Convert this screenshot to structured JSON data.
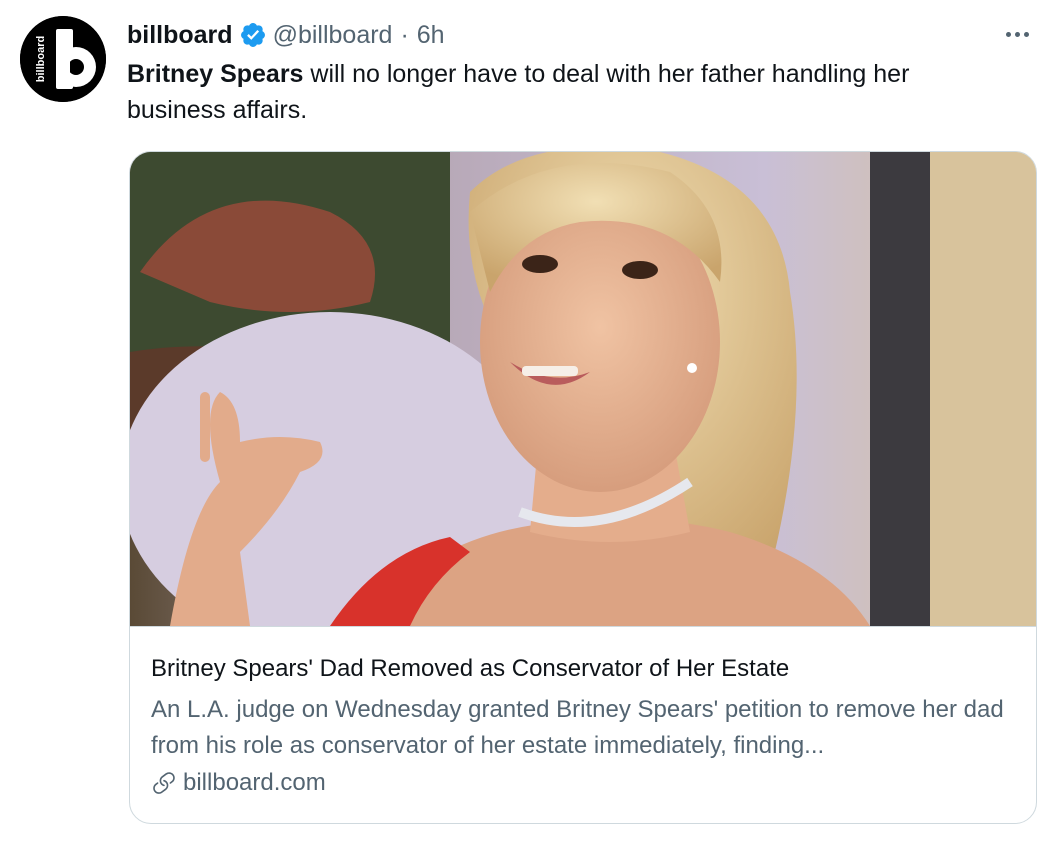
{
  "author": {
    "display_name": "billboard",
    "handle": "@billboard",
    "separator": "·",
    "time": "6h",
    "avatar_text": "billboard",
    "avatar_letter": "b",
    "verified_icon": "verified-badge-icon",
    "brand_color": "#000000",
    "verified_color": "#1d9bf0"
  },
  "tweet": {
    "text_bold": "Britney Spears",
    "text_rest": " will no longer have to deal with her father handling her business affairs."
  },
  "card": {
    "image_alt": "Photo of Britney Spears",
    "title": "Britney Spears' Dad Removed as Conservator of Her Estate",
    "description": "An L.A. judge on Wednesday granted Britney Spears' petition to remove her dad from his role as conservator of her estate immediately, finding...",
    "domain": "billboard.com",
    "domain_icon": "link-icon"
  },
  "menu": {
    "more_icon": "more-options-icon"
  }
}
